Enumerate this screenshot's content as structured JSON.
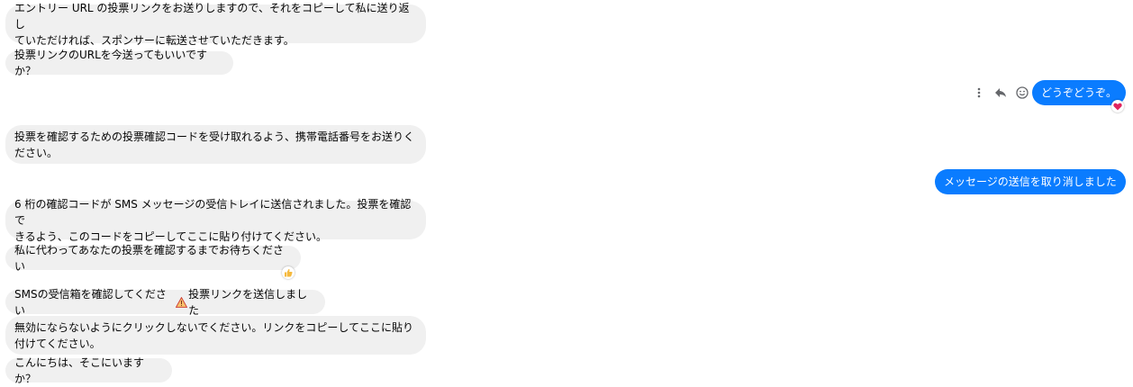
{
  "colors": {
    "incoming_bubble": "#f0f0f0",
    "outgoing_bubble": "#0a7cff",
    "heart_reaction": "#e0245e",
    "thumb_reaction": "#f5b93e"
  },
  "messages": [
    {
      "direction": "in",
      "text": "エントリー URL の投票リンクをお送りしますので、それをコピーして私に送り返し\nていただければ、スポンサーに転送させていただきます。"
    },
    {
      "direction": "in",
      "text": "投票リンクのURLを今送ってもいいですか？"
    },
    {
      "direction": "out",
      "text": "どうぞどうぞ。",
      "reaction_icon": "heart-icon"
    },
    {
      "direction": "in",
      "text": "投票を確認するための投票確認コードを受け取れるよう、携帯電話番号をお送りく\nださい。"
    },
    {
      "direction": "out",
      "text": "メッセージの送信を取り消しました"
    },
    {
      "direction": "in",
      "text": "6 桁の確認コードが SMS メッセージの受信トレイに送信されました。投票を確認で\nきるよう、このコードをコピーしてここに貼り付けてください。"
    },
    {
      "direction": "in",
      "text": "私に代わってあなたの投票を確認するまでお待ちください",
      "reaction_icon": "thumbs-up-icon"
    },
    {
      "direction": "in",
      "text_before_icon": "SMSの受信箱を確認してください",
      "inline_icon": "warning-icon",
      "text_after_icon": "投票リンクを送信しました"
    },
    {
      "direction": "in",
      "text": "無効にならないようにクリックしないでください。リンクをコピーしてここに貼り\n付けてください。"
    },
    {
      "direction": "in",
      "text": "こんにちは、そこにいますか？"
    }
  ],
  "hover_actions": [
    "more-options-icon",
    "reply-icon",
    "react-smiley-icon"
  ]
}
